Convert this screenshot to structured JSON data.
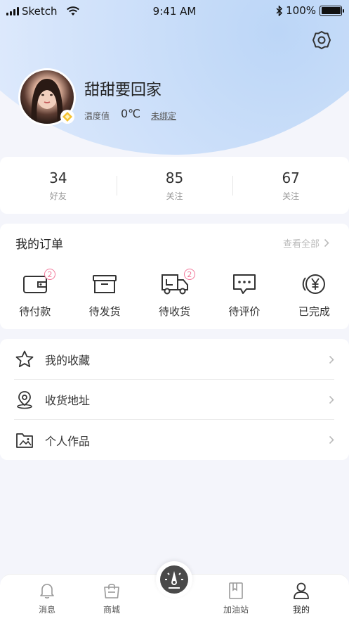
{
  "status_bar": {
    "carrier": "Sketch",
    "time": "9:41 AM",
    "battery": "100%"
  },
  "profile": {
    "name": "甜甜要回家",
    "temperature_label": "温度值",
    "temperature_value": "0℃",
    "unbound_label": "未绑定"
  },
  "stats": [
    {
      "value": "34",
      "label": "好友"
    },
    {
      "value": "85",
      "label": "关注"
    },
    {
      "value": "67",
      "label": "关注"
    }
  ],
  "orders": {
    "title": "我的订单",
    "view_all": "查看全部",
    "items": [
      {
        "label": "待付款",
        "icon": "wallet-icon",
        "badge": "2"
      },
      {
        "label": "待发货",
        "icon": "package-box-icon",
        "badge": ""
      },
      {
        "label": "待收货",
        "icon": "delivery-truck-icon",
        "badge": "2"
      },
      {
        "label": "待评价",
        "icon": "comment-icon",
        "badge": ""
      },
      {
        "label": "已完成",
        "icon": "yen-coin-icon",
        "badge": ""
      }
    ]
  },
  "menu": [
    {
      "label": "我的收藏",
      "icon": "star-icon"
    },
    {
      "label": "收货地址",
      "icon": "location-pin-icon"
    },
    {
      "label": "个人作品",
      "icon": "photo-folder-icon"
    }
  ],
  "tabbar": [
    {
      "label": "消息",
      "icon": "bell-icon"
    },
    {
      "label": "商城",
      "icon": "shopping-bag-icon"
    },
    {
      "label": "加油站",
      "icon": "book-icon"
    },
    {
      "label": "我的",
      "icon": "user-icon"
    }
  ],
  "colors": {
    "accent_badge": "#f2789a",
    "hero_gradient": "#bcd6f7",
    "background": "#f4f5fb"
  }
}
